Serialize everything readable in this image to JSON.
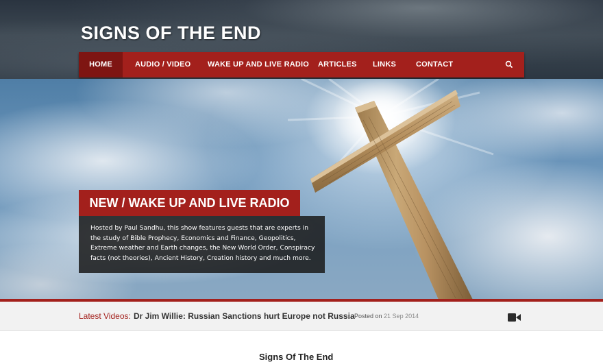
{
  "header": {
    "logo": "SIGNS OF THE END"
  },
  "nav": {
    "items": [
      {
        "label": "HOME",
        "active": true
      },
      {
        "label": "AUDIO / VIDEO"
      },
      {
        "label": "WAKE UP AND LIVE RADIO"
      },
      {
        "label": "ARTICLES"
      },
      {
        "label": "LINKS"
      },
      {
        "label": "CONTACT"
      }
    ],
    "search_icon": "search-icon"
  },
  "hero": {
    "title": "NEW / WAKE UP AND LIVE RADIO",
    "description": "Hosted by Paul Sandhu, this show features guests that are experts in the study of Bible Prophecy, Economics and Finance, Geopolitics, Extreme weather and Earth changes, the New World Order, Conspiracy facts (not theories), Ancient History, Creation history and much more."
  },
  "ticker": {
    "label": "Latest Videos:",
    "link": "Dr Jim Willie: Russian Sanctions hurt Europe not Russia",
    "separator": "-",
    "posted_prefix": "Posted on",
    "date": "21 Sep 2014",
    "icon": "video-camera-icon"
  },
  "content": {
    "title": "Signs Of The End"
  },
  "colors": {
    "accent": "#a3201c",
    "accent_dark": "#7e1512",
    "caption_bg": "#191919"
  }
}
